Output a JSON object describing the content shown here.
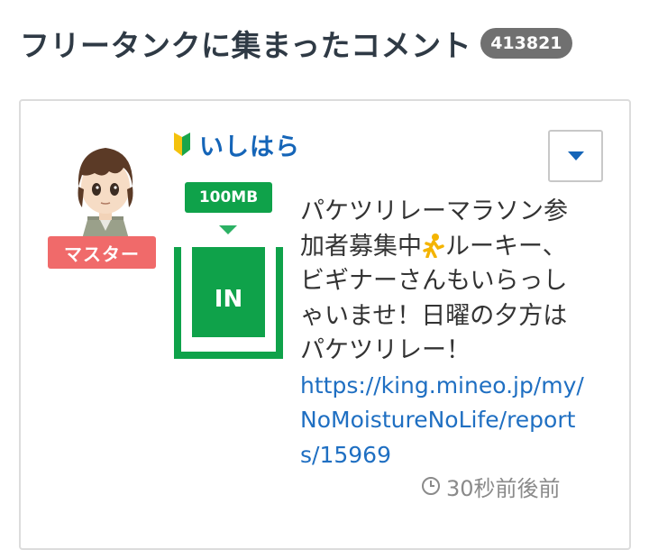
{
  "header": {
    "title": "フリータンクに集まったコメント",
    "count": "413821"
  },
  "comment": {
    "user": {
      "name": "いしはら",
      "rank": "マスター",
      "beginner_icon": "beginner-mark-icon",
      "avatar": "anime-style-avatar"
    },
    "badge": {
      "amount": "100MB",
      "direction": "IN"
    },
    "text_parts": {
      "before_icon": "パケツリレーマラソン参加者募集中",
      "icon": "runner-icon",
      "after_icon": "ルーキー、ビギナーさんもいらっしゃいませ！日曜の夕方はパケツリレー！"
    },
    "link": "https://king.mineo.jp/my/NoMoistureNoLife/reports/15969",
    "time": "30秒前後前",
    "time_icon": "clock-icon",
    "menu_icon": "caret-down-icon"
  },
  "colors": {
    "accent_blue": "#1565b8",
    "link_blue": "#1f6fc2",
    "green": "#0fa24a",
    "rank_red": "#f06a6a",
    "count_gray": "#707070"
  }
}
